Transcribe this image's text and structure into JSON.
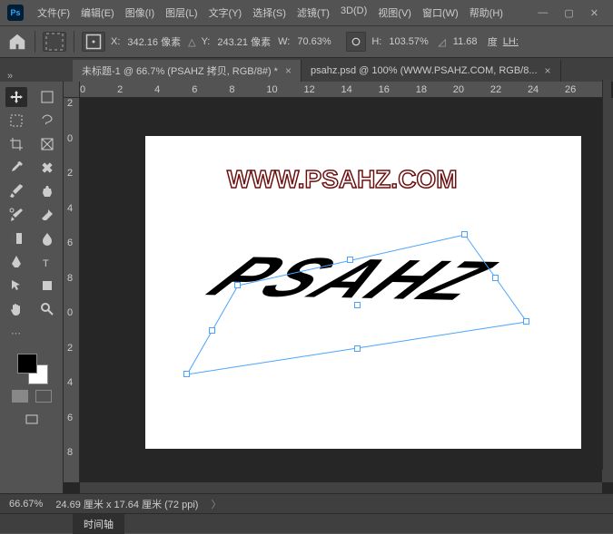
{
  "menu": {
    "file": "文件(F)",
    "edit": "编辑(E)",
    "image": "图像(I)",
    "layer": "图层(L)",
    "type": "文字(Y)",
    "select": "选择(S)",
    "filter": "滤镜(T)",
    "threeD": "3D(D)",
    "view": "视图(V)",
    "window": "窗口(W)",
    "help": "帮助(H)"
  },
  "options": {
    "x_label": "X:",
    "x_value": "342.16 像素",
    "y_label": "Y:",
    "y_value": "243.21 像素",
    "w_label": "W:",
    "w_value": "70.63%",
    "h_label": "H:",
    "h_value": "103.57%",
    "angle_value": "11.68",
    "deg_label": "度",
    "lh_label": "LH:"
  },
  "tabs": [
    {
      "title": "未标题-1 @ 66.7% (PSAHZ 拷贝, RGB/8#) *"
    },
    {
      "title": "psahz.psd @ 100% (WWW.PSAHZ.COM, RGB/8..."
    }
  ],
  "ruler_h": [
    "0",
    "2",
    "4",
    "6",
    "8",
    "10",
    "12",
    "14",
    "16",
    "18",
    "20",
    "22",
    "24",
    "26"
  ],
  "ruler_v": [
    "2",
    "0",
    "2",
    "4",
    "6",
    "8",
    "0",
    "2",
    "4",
    "6",
    "8"
  ],
  "canvas": {
    "watermark": "WWW.PSAHZ.COM",
    "text": "PSAHZ"
  },
  "status": {
    "zoom": "66.67%",
    "dims": "24.69 厘米 x 17.64 厘米 (72 ppi)"
  },
  "panel": {
    "timeline": "时间轴"
  }
}
